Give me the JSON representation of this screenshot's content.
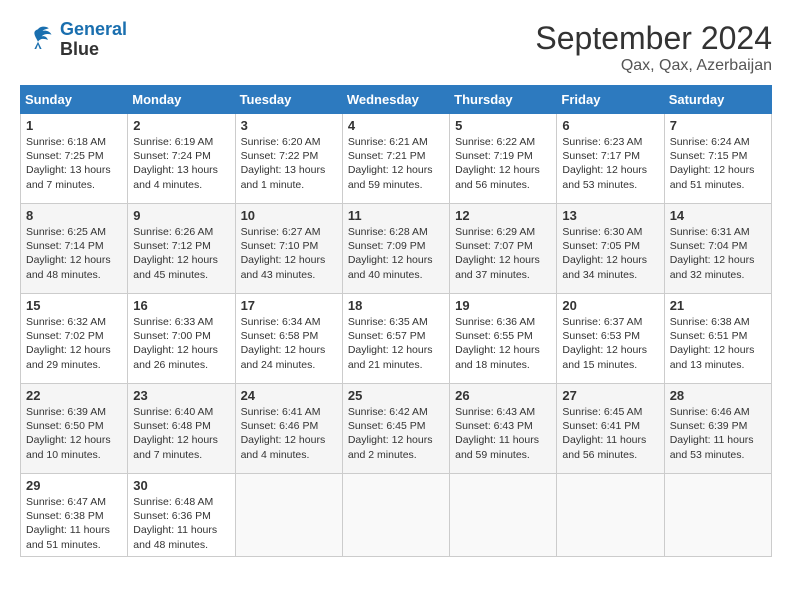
{
  "header": {
    "logo_line1": "General",
    "logo_line2": "Blue",
    "month_title": "September 2024",
    "subtitle": "Qax, Qax, Azerbaijan"
  },
  "days_header": [
    "Sunday",
    "Monday",
    "Tuesday",
    "Wednesday",
    "Thursday",
    "Friday",
    "Saturday"
  ],
  "weeks": [
    [
      {
        "day": "1",
        "info": "Sunrise: 6:18 AM\nSunset: 7:25 PM\nDaylight: 13 hours\nand 7 minutes."
      },
      {
        "day": "2",
        "info": "Sunrise: 6:19 AM\nSunset: 7:24 PM\nDaylight: 13 hours\nand 4 minutes."
      },
      {
        "day": "3",
        "info": "Sunrise: 6:20 AM\nSunset: 7:22 PM\nDaylight: 13 hours\nand 1 minute."
      },
      {
        "day": "4",
        "info": "Sunrise: 6:21 AM\nSunset: 7:21 PM\nDaylight: 12 hours\nand 59 minutes."
      },
      {
        "day": "5",
        "info": "Sunrise: 6:22 AM\nSunset: 7:19 PM\nDaylight: 12 hours\nand 56 minutes."
      },
      {
        "day": "6",
        "info": "Sunrise: 6:23 AM\nSunset: 7:17 PM\nDaylight: 12 hours\nand 53 minutes."
      },
      {
        "day": "7",
        "info": "Sunrise: 6:24 AM\nSunset: 7:15 PM\nDaylight: 12 hours\nand 51 minutes."
      }
    ],
    [
      {
        "day": "8",
        "info": "Sunrise: 6:25 AM\nSunset: 7:14 PM\nDaylight: 12 hours\nand 48 minutes."
      },
      {
        "day": "9",
        "info": "Sunrise: 6:26 AM\nSunset: 7:12 PM\nDaylight: 12 hours\nand 45 minutes."
      },
      {
        "day": "10",
        "info": "Sunrise: 6:27 AM\nSunset: 7:10 PM\nDaylight: 12 hours\nand 43 minutes."
      },
      {
        "day": "11",
        "info": "Sunrise: 6:28 AM\nSunset: 7:09 PM\nDaylight: 12 hours\nand 40 minutes."
      },
      {
        "day": "12",
        "info": "Sunrise: 6:29 AM\nSunset: 7:07 PM\nDaylight: 12 hours\nand 37 minutes."
      },
      {
        "day": "13",
        "info": "Sunrise: 6:30 AM\nSunset: 7:05 PM\nDaylight: 12 hours\nand 34 minutes."
      },
      {
        "day": "14",
        "info": "Sunrise: 6:31 AM\nSunset: 7:04 PM\nDaylight: 12 hours\nand 32 minutes."
      }
    ],
    [
      {
        "day": "15",
        "info": "Sunrise: 6:32 AM\nSunset: 7:02 PM\nDaylight: 12 hours\nand 29 minutes."
      },
      {
        "day": "16",
        "info": "Sunrise: 6:33 AM\nSunset: 7:00 PM\nDaylight: 12 hours\nand 26 minutes."
      },
      {
        "day": "17",
        "info": "Sunrise: 6:34 AM\nSunset: 6:58 PM\nDaylight: 12 hours\nand 24 minutes."
      },
      {
        "day": "18",
        "info": "Sunrise: 6:35 AM\nSunset: 6:57 PM\nDaylight: 12 hours\nand 21 minutes."
      },
      {
        "day": "19",
        "info": "Sunrise: 6:36 AM\nSunset: 6:55 PM\nDaylight: 12 hours\nand 18 minutes."
      },
      {
        "day": "20",
        "info": "Sunrise: 6:37 AM\nSunset: 6:53 PM\nDaylight: 12 hours\nand 15 minutes."
      },
      {
        "day": "21",
        "info": "Sunrise: 6:38 AM\nSunset: 6:51 PM\nDaylight: 12 hours\nand 13 minutes."
      }
    ],
    [
      {
        "day": "22",
        "info": "Sunrise: 6:39 AM\nSunset: 6:50 PM\nDaylight: 12 hours\nand 10 minutes."
      },
      {
        "day": "23",
        "info": "Sunrise: 6:40 AM\nSunset: 6:48 PM\nDaylight: 12 hours\nand 7 minutes."
      },
      {
        "day": "24",
        "info": "Sunrise: 6:41 AM\nSunset: 6:46 PM\nDaylight: 12 hours\nand 4 minutes."
      },
      {
        "day": "25",
        "info": "Sunrise: 6:42 AM\nSunset: 6:45 PM\nDaylight: 12 hours\nand 2 minutes."
      },
      {
        "day": "26",
        "info": "Sunrise: 6:43 AM\nSunset: 6:43 PM\nDaylight: 11 hours\nand 59 minutes."
      },
      {
        "day": "27",
        "info": "Sunrise: 6:45 AM\nSunset: 6:41 PM\nDaylight: 11 hours\nand 56 minutes."
      },
      {
        "day": "28",
        "info": "Sunrise: 6:46 AM\nSunset: 6:39 PM\nDaylight: 11 hours\nand 53 minutes."
      }
    ],
    [
      {
        "day": "29",
        "info": "Sunrise: 6:47 AM\nSunset: 6:38 PM\nDaylight: 11 hours\nand 51 minutes."
      },
      {
        "day": "30",
        "info": "Sunrise: 6:48 AM\nSunset: 6:36 PM\nDaylight: 11 hours\nand 48 minutes."
      },
      {
        "day": "",
        "info": ""
      },
      {
        "day": "",
        "info": ""
      },
      {
        "day": "",
        "info": ""
      },
      {
        "day": "",
        "info": ""
      },
      {
        "day": "",
        "info": ""
      }
    ]
  ]
}
